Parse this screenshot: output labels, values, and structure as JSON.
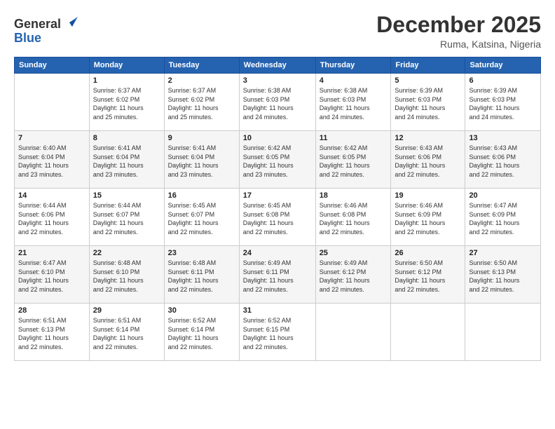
{
  "logo": {
    "general": "General",
    "blue": "Blue"
  },
  "title": "December 2025",
  "location": "Ruma, Katsina, Nigeria",
  "days_of_week": [
    "Sunday",
    "Monday",
    "Tuesday",
    "Wednesday",
    "Thursday",
    "Friday",
    "Saturday"
  ],
  "weeks": [
    [
      {
        "day": "",
        "sunrise": "",
        "sunset": "",
        "daylight": ""
      },
      {
        "day": "1",
        "sunrise": "Sunrise: 6:37 AM",
        "sunset": "Sunset: 6:02 PM",
        "daylight": "Daylight: 11 hours and 25 minutes."
      },
      {
        "day": "2",
        "sunrise": "Sunrise: 6:37 AM",
        "sunset": "Sunset: 6:02 PM",
        "daylight": "Daylight: 11 hours and 25 minutes."
      },
      {
        "day": "3",
        "sunrise": "Sunrise: 6:38 AM",
        "sunset": "Sunset: 6:03 PM",
        "daylight": "Daylight: 11 hours and 24 minutes."
      },
      {
        "day": "4",
        "sunrise": "Sunrise: 6:38 AM",
        "sunset": "Sunset: 6:03 PM",
        "daylight": "Daylight: 11 hours and 24 minutes."
      },
      {
        "day": "5",
        "sunrise": "Sunrise: 6:39 AM",
        "sunset": "Sunset: 6:03 PM",
        "daylight": "Daylight: 11 hours and 24 minutes."
      },
      {
        "day": "6",
        "sunrise": "Sunrise: 6:39 AM",
        "sunset": "Sunset: 6:03 PM",
        "daylight": "Daylight: 11 hours and 24 minutes."
      }
    ],
    [
      {
        "day": "7",
        "sunrise": "Sunrise: 6:40 AM",
        "sunset": "Sunset: 6:04 PM",
        "daylight": "Daylight: 11 hours and 23 minutes."
      },
      {
        "day": "8",
        "sunrise": "Sunrise: 6:41 AM",
        "sunset": "Sunset: 6:04 PM",
        "daylight": "Daylight: 11 hours and 23 minutes."
      },
      {
        "day": "9",
        "sunrise": "Sunrise: 6:41 AM",
        "sunset": "Sunset: 6:04 PM",
        "daylight": "Daylight: 11 hours and 23 minutes."
      },
      {
        "day": "10",
        "sunrise": "Sunrise: 6:42 AM",
        "sunset": "Sunset: 6:05 PM",
        "daylight": "Daylight: 11 hours and 23 minutes."
      },
      {
        "day": "11",
        "sunrise": "Sunrise: 6:42 AM",
        "sunset": "Sunset: 6:05 PM",
        "daylight": "Daylight: 11 hours and 22 minutes."
      },
      {
        "day": "12",
        "sunrise": "Sunrise: 6:43 AM",
        "sunset": "Sunset: 6:06 PM",
        "daylight": "Daylight: 11 hours and 22 minutes."
      },
      {
        "day": "13",
        "sunrise": "Sunrise: 6:43 AM",
        "sunset": "Sunset: 6:06 PM",
        "daylight": "Daylight: 11 hours and 22 minutes."
      }
    ],
    [
      {
        "day": "14",
        "sunrise": "Sunrise: 6:44 AM",
        "sunset": "Sunset: 6:06 PM",
        "daylight": "Daylight: 11 hours and 22 minutes."
      },
      {
        "day": "15",
        "sunrise": "Sunrise: 6:44 AM",
        "sunset": "Sunset: 6:07 PM",
        "daylight": "Daylight: 11 hours and 22 minutes."
      },
      {
        "day": "16",
        "sunrise": "Sunrise: 6:45 AM",
        "sunset": "Sunset: 6:07 PM",
        "daylight": "Daylight: 11 hours and 22 minutes."
      },
      {
        "day": "17",
        "sunrise": "Sunrise: 6:45 AM",
        "sunset": "Sunset: 6:08 PM",
        "daylight": "Daylight: 11 hours and 22 minutes."
      },
      {
        "day": "18",
        "sunrise": "Sunrise: 6:46 AM",
        "sunset": "Sunset: 6:08 PM",
        "daylight": "Daylight: 11 hours and 22 minutes."
      },
      {
        "day": "19",
        "sunrise": "Sunrise: 6:46 AM",
        "sunset": "Sunset: 6:09 PM",
        "daylight": "Daylight: 11 hours and 22 minutes."
      },
      {
        "day": "20",
        "sunrise": "Sunrise: 6:47 AM",
        "sunset": "Sunset: 6:09 PM",
        "daylight": "Daylight: 11 hours and 22 minutes."
      }
    ],
    [
      {
        "day": "21",
        "sunrise": "Sunrise: 6:47 AM",
        "sunset": "Sunset: 6:10 PM",
        "daylight": "Daylight: 11 hours and 22 minutes."
      },
      {
        "day": "22",
        "sunrise": "Sunrise: 6:48 AM",
        "sunset": "Sunset: 6:10 PM",
        "daylight": "Daylight: 11 hours and 22 minutes."
      },
      {
        "day": "23",
        "sunrise": "Sunrise: 6:48 AM",
        "sunset": "Sunset: 6:11 PM",
        "daylight": "Daylight: 11 hours and 22 minutes."
      },
      {
        "day": "24",
        "sunrise": "Sunrise: 6:49 AM",
        "sunset": "Sunset: 6:11 PM",
        "daylight": "Daylight: 11 hours and 22 minutes."
      },
      {
        "day": "25",
        "sunrise": "Sunrise: 6:49 AM",
        "sunset": "Sunset: 6:12 PM",
        "daylight": "Daylight: 11 hours and 22 minutes."
      },
      {
        "day": "26",
        "sunrise": "Sunrise: 6:50 AM",
        "sunset": "Sunset: 6:12 PM",
        "daylight": "Daylight: 11 hours and 22 minutes."
      },
      {
        "day": "27",
        "sunrise": "Sunrise: 6:50 AM",
        "sunset": "Sunset: 6:13 PM",
        "daylight": "Daylight: 11 hours and 22 minutes."
      }
    ],
    [
      {
        "day": "28",
        "sunrise": "Sunrise: 6:51 AM",
        "sunset": "Sunset: 6:13 PM",
        "daylight": "Daylight: 11 hours and 22 minutes."
      },
      {
        "day": "29",
        "sunrise": "Sunrise: 6:51 AM",
        "sunset": "Sunset: 6:14 PM",
        "daylight": "Daylight: 11 hours and 22 minutes."
      },
      {
        "day": "30",
        "sunrise": "Sunrise: 6:52 AM",
        "sunset": "Sunset: 6:14 PM",
        "daylight": "Daylight: 11 hours and 22 minutes."
      },
      {
        "day": "31",
        "sunrise": "Sunrise: 6:52 AM",
        "sunset": "Sunset: 6:15 PM",
        "daylight": "Daylight: 11 hours and 22 minutes."
      },
      {
        "day": "",
        "sunrise": "",
        "sunset": "",
        "daylight": ""
      },
      {
        "day": "",
        "sunrise": "",
        "sunset": "",
        "daylight": ""
      },
      {
        "day": "",
        "sunrise": "",
        "sunset": "",
        "daylight": ""
      }
    ]
  ]
}
